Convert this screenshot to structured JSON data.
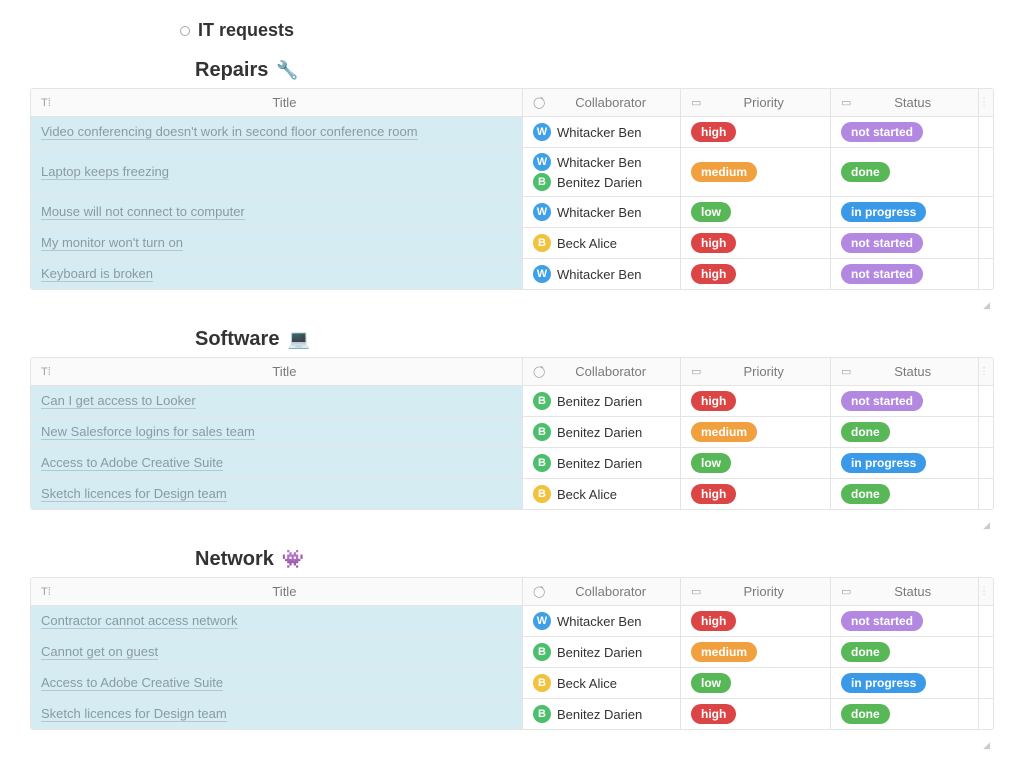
{
  "page": {
    "title": "IT requests"
  },
  "columns": {
    "title": "Title",
    "collaborator": "Collaborator",
    "priority": "Priority",
    "status": "Status"
  },
  "collaborators": {
    "whitacker": {
      "avatarLetter": "W",
      "avatarColor": "#3fa0e8",
      "name": "Whitacker Ben"
    },
    "benitez": {
      "avatarLetter": "B",
      "avatarColor": "#4bbf6b",
      "name": "Benitez Darien"
    },
    "beck": {
      "avatarLetter": "B",
      "avatarColor": "#f0c23e",
      "name": "Beck Alice"
    }
  },
  "pills": {
    "high": {
      "text": "high",
      "color": "#db4545"
    },
    "medium": {
      "text": "medium",
      "color": "#f0a03e"
    },
    "low": {
      "text": "low",
      "color": "#58b858"
    },
    "not_started": {
      "text": "not started",
      "color": "#b288e0"
    },
    "done": {
      "text": "done",
      "color": "#58b858"
    },
    "in_progress": {
      "text": "in progress",
      "color": "#3b9ae8"
    }
  },
  "sections": [
    {
      "title": "Repairs",
      "emoji": "🔧",
      "rows": [
        {
          "title": "Video conferencing doesn't work in second floor conference room",
          "collaborators": [
            "whitacker"
          ],
          "priority": "high",
          "status": "not_started"
        },
        {
          "title": "Laptop keeps freezing",
          "collaborators": [
            "whitacker",
            "benitez"
          ],
          "priority": "medium",
          "status": "done"
        },
        {
          "title": "Mouse will not connect to computer",
          "collaborators": [
            "whitacker"
          ],
          "priority": "low",
          "status": "in_progress"
        },
        {
          "title": "My monitor won't turn on",
          "collaborators": [
            "beck"
          ],
          "priority": "high",
          "status": "not_started"
        },
        {
          "title": "Keyboard is broken",
          "collaborators": [
            "whitacker"
          ],
          "priority": "high",
          "status": "not_started"
        }
      ]
    },
    {
      "title": "Software",
      "emoji": "💻",
      "rows": [
        {
          "title": "Can I get access to Looker",
          "collaborators": [
            "benitez"
          ],
          "priority": "high",
          "status": "not_started"
        },
        {
          "title": "New Salesforce logins for sales team",
          "collaborators": [
            "benitez"
          ],
          "priority": "medium",
          "status": "done"
        },
        {
          "title": "Access to Adobe Creative Suite",
          "collaborators": [
            "benitez"
          ],
          "priority": "low",
          "status": "in_progress"
        },
        {
          "title": "Sketch licences for Design team",
          "collaborators": [
            "beck"
          ],
          "priority": "high",
          "status": "done"
        }
      ]
    },
    {
      "title": "Network",
      "emoji": "👾",
      "rows": [
        {
          "title": "Contractor cannot access network",
          "collaborators": [
            "whitacker"
          ],
          "priority": "high",
          "status": "not_started"
        },
        {
          "title": "Cannot get on guest",
          "collaborators": [
            "benitez"
          ],
          "priority": "medium",
          "status": "done"
        },
        {
          "title": "Access to Adobe Creative Suite",
          "collaborators": [
            "beck"
          ],
          "priority": "low",
          "status": "in_progress"
        },
        {
          "title": "Sketch licences for Design team",
          "collaborators": [
            "benitez"
          ],
          "priority": "high",
          "status": "done"
        }
      ]
    }
  ]
}
